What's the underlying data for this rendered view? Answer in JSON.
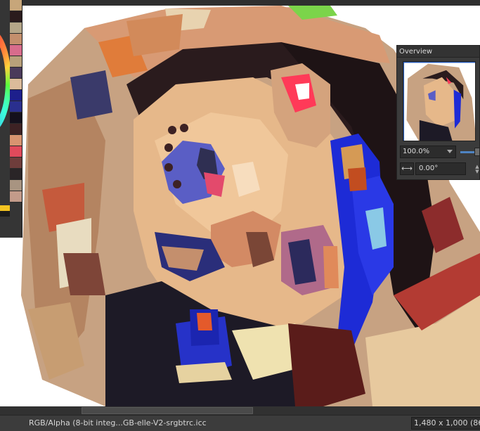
{
  "palette": {
    "swatches": [
      "#c7a67a",
      "#2a1b1d",
      "#b5a688",
      "#c48f6d",
      "#d86c8c",
      "#b8a07a",
      "#4a3a5a",
      "#dbbb9a",
      "#1d1f8c",
      "#2a2f8e",
      "#14101c",
      "#3d2224",
      "#d89470",
      "#e04a5b",
      "#6e3d3b",
      "#2a2527",
      "#a89481",
      "#c39b8a"
    ],
    "foreground_color": "#f3c321",
    "background_color": "#1b1b1b"
  },
  "overview": {
    "title": "Overview",
    "zoom": "100.0%",
    "rotation": "0.00°",
    "rotate_icon": "rotate-icon",
    "zoom_dropdown_icon": "chevron-down-icon"
  },
  "statusbar": {
    "color_profile": "RGB/Alpha (8-bit integ...GB-elle-V2-srgbtrc.icc",
    "dimensions": "1,480 x 1,000 (86.2"
  }
}
